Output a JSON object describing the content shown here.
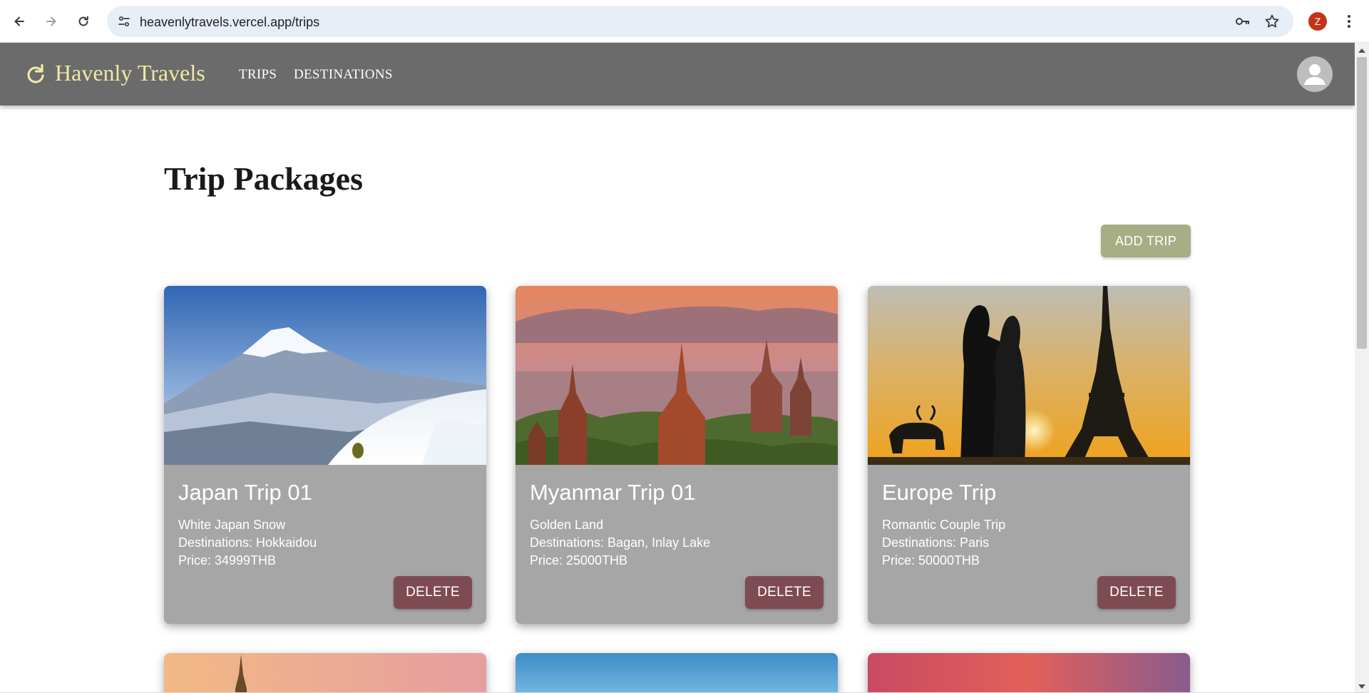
{
  "browser": {
    "url": "heavenlytravels.vercel.app/trips",
    "profile_initial": "Z"
  },
  "header": {
    "brand": "Havenly Travels",
    "nav": [
      {
        "label": "TRIPS"
      },
      {
        "label": "DESTINATIONS"
      }
    ]
  },
  "main": {
    "title": "Trip Packages",
    "add_trip_label": "ADD TRIP",
    "trips": [
      {
        "title": "Japan Trip 01",
        "subtitle": "White Japan Snow",
        "destinations": "Destinations: Hokkaidou",
        "price": "Price: 34999THB",
        "delete_label": "DELETE",
        "image": "snowy-mountain-skier"
      },
      {
        "title": "Myanmar Trip 01",
        "subtitle": "Golden Land",
        "destinations": "Destinations: Bagan, Inlay Lake",
        "price": "Price: 25000THB",
        "delete_label": "DELETE",
        "image": "bagan-temples-sunrise"
      },
      {
        "title": "Europe Trip",
        "subtitle": "Romantic Couple Trip",
        "destinations": "Destinations: Paris",
        "price": "Price: 50000THB",
        "delete_label": "DELETE",
        "image": "couple-eiffel-tower-sunset"
      }
    ],
    "peek_images": [
      "temple-spire-dusk",
      "blue-sky",
      "red-clouds-sunset"
    ]
  },
  "colors": {
    "header_bg": "#6b6b6b",
    "brand": "#efe9a4",
    "card_bg": "#a6a6a6",
    "delete_btn": "#7e4b52",
    "add_btn": "#a7ad84"
  }
}
